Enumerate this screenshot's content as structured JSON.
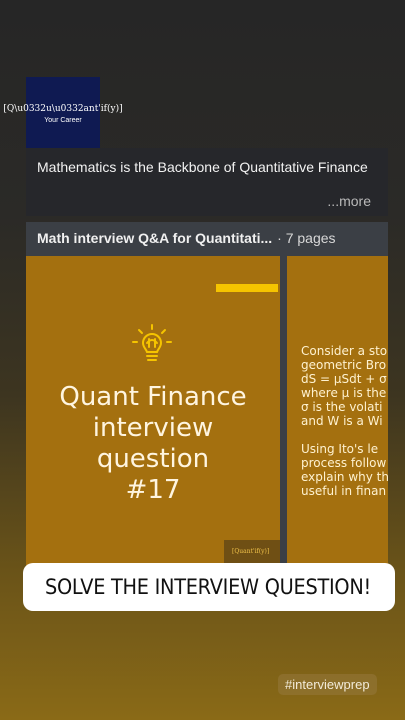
{
  "logo": {
    "brand": "[Q\\u0332u\\u0332ant'if(y)]",
    "tagline": "Your Career"
  },
  "post": {
    "text": "Mathematics is the Backbone of Quantitative Finance",
    "more_label": "...more"
  },
  "document": {
    "title": "Math interview Q&A for Quantitati...",
    "pages": "· 7 pages"
  },
  "slides": [
    {
      "title": "Quant Finance\ninterview\nquestion\n#17",
      "footer_logo": "[Quant'if(y)]"
    },
    {
      "text": "Consider a sto\ngeometric Bro\ndS = μSdt + σ\nwhere μ is the\nσ is the volati\nand W is a Wi\n\nUsing Ito's le\nprocess follow\nexplain why th\nuseful in finan"
    }
  ],
  "cta": {
    "label": "SOLVE THE INTERVIEW QUESTION!",
    "icon": "link-icon"
  },
  "hashtag": "#interviewprep",
  "colors": {
    "slide_bg": "#a4700f",
    "stripe": "#f5c400",
    "logo_bg": "#0f1a52"
  }
}
